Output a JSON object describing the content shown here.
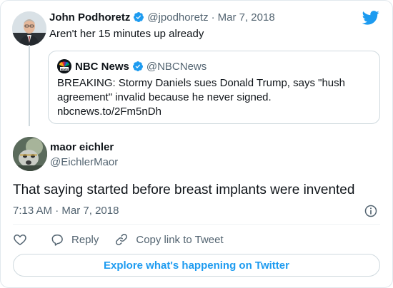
{
  "colors": {
    "brand": "#1d9bf0",
    "text": "#0f1419",
    "muted": "#536471",
    "border": "#cfd9de"
  },
  "parent_tweet": {
    "author_name": "John Podhoretz",
    "handle": "@jpodhoretz",
    "separator": "·",
    "date": "Mar 7, 2018",
    "text": "Aren't her 15 minutes up already",
    "verified_icon": "verified-badge-icon"
  },
  "quoted_tweet": {
    "author_name": "NBC News",
    "handle": "@NBCNews",
    "text": "BREAKING: Stormy Daniels sues Donald Trump, says \"hush agreement\" invalid because he never signed.",
    "link": "nbcnews.to/2Fm5nDh",
    "logo_icon": "nbc-peacock-logo"
  },
  "main_tweet": {
    "author_name": "maor eichler",
    "handle": "@EichlerMaor",
    "text": "That saying started before breast implants were invented",
    "time": "7:13 AM",
    "separator": "·",
    "date": "Mar 7, 2018"
  },
  "actions": {
    "like_icon": "heart-icon",
    "reply_label": "Reply",
    "copy_link_label": "Copy link to Tweet"
  },
  "explore_label": "Explore what's happening on Twitter"
}
